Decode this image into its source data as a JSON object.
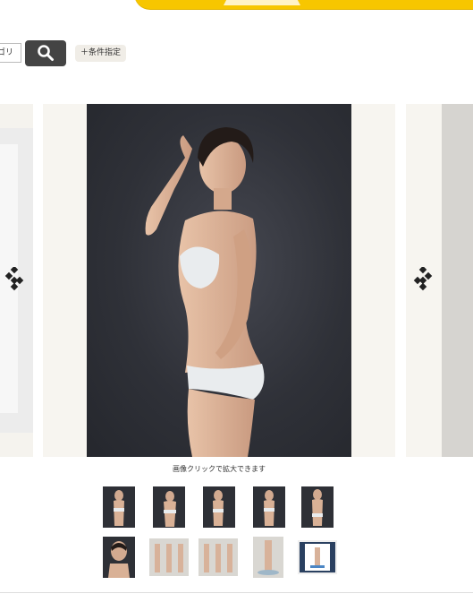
{
  "header": {
    "accent_color": "#f7c600"
  },
  "search": {
    "category_value": "ゴリ",
    "button_icon": "search-icon"
  },
  "filter": {
    "label": "＋条件指定"
  },
  "gallery": {
    "caption": "画像クリックで拡大できます",
    "prev_icon": "chevron-left-icon",
    "next_icon": "chevron-right-icon",
    "thumbnails_row1": [
      "thumb-1",
      "thumb-2",
      "thumb-3",
      "thumb-4",
      "thumb-5"
    ],
    "thumbnails_row2": [
      "thumb-6",
      "thumb-7",
      "thumb-8",
      "thumb-9",
      "thumb-10"
    ]
  }
}
